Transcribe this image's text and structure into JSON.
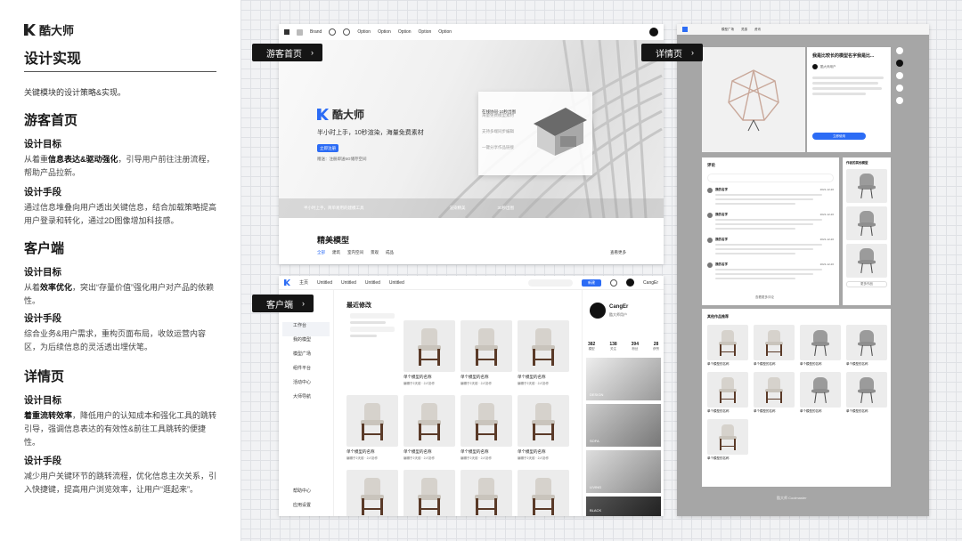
{
  "left": {
    "logo": "酷大师",
    "title": "设计实现",
    "intro": "关键模块的设计策略&实现。",
    "sections": [
      {
        "title": "游客首页",
        "goal_label": "设计目标",
        "goal_pre": "从着重",
        "goal_bold": "信息表达&驱动强化",
        "goal_post": "，引导用户前往注册流程，帮助产品拉新。",
        "means_label": "设计手段",
        "means": "通过信息堆叠向用户透出关键信息，结合加载策略提高用户登录和转化，通过2D图像增加科技感。"
      },
      {
        "title": "客户端",
        "goal_label": "设计目标",
        "goal_pre": "从着",
        "goal_bold": "效率优化",
        "goal_post": "，突出“存量价值”强化用户对产品的依赖性。",
        "means_label": "设计手段",
        "means": "综合业务&用户需求，重构页面布局，收敛运营内容区，为后续信息的灵活透出埋伏笔。"
      },
      {
        "title": "详情页",
        "goal_label": "设计目标",
        "goal_pre": "",
        "goal_bold": "着重流转效率",
        "goal_post": "，降低用户的认知成本和强化工具的跳转引导，强调信息表达的有效性&前往工具跳转的便捷性。",
        "means_label": "设计手段",
        "means": "减少用户关键环节的跳转流程，优化信息主次关系，引入快捷键，提高用户浏览效率，让用户“逛起来”。"
      }
    ]
  },
  "tags": {
    "guest": "游客首页",
    "detail": "详情页",
    "client": "客户端",
    "arrow": "›"
  },
  "guest": {
    "brand": "Brand",
    "options": [
      "Option",
      "Option",
      "Option",
      "Option",
      "Option"
    ],
    "hero_logo": "酷大师",
    "hero_slogan": "半小时上手，10秒渲染，海量免费素材",
    "hero_btn": "立即注册",
    "hero_note": "赠送：注册即送5G储存空间",
    "features": [
      "在线协同·10秒出图",
      "海量免费模型素材",
      "支持多端同步编辑",
      "一键分享作品链接"
    ],
    "strip": [
      "半小时上手，简单易用的建模工具",
      "渲染精美",
      "30秒出图"
    ],
    "section_title": "精美模型",
    "filters": [
      "全部",
      "建筑",
      "室内空间",
      "景观",
      "成品"
    ],
    "more": "查看更多"
  },
  "client": {
    "top_tabs": [
      "主页",
      "Untitled",
      "Untitled",
      "Untitled",
      "Untitled"
    ],
    "new_btn": "新建",
    "user": "CangEr",
    "side_items": [
      "工作台",
      "我的模型",
      "模型广场",
      "组件平台",
      "活动中心",
      "大师导航"
    ],
    "side_bottom": [
      "帮助中心",
      "应用设置"
    ],
    "list_title": "最近修改",
    "filter_groups": [
      "最近修改",
      "最近打开",
      "排序",
      "视图"
    ],
    "card_title": "单个模型的名称",
    "card_meta": [
      "编辑于2天前",
      "2人协作"
    ],
    "profile_name": "CangEr",
    "profile_sub": "酷大师用户",
    "stats": [
      {
        "num": "382",
        "label": "模型"
      },
      {
        "num": "138",
        "label": "关注"
      },
      {
        "num": "394",
        "label": "粉丝"
      },
      {
        "num": "28",
        "label": "获赞"
      }
    ],
    "banners": [
      "DESIGN",
      "SOFA",
      "LIVING",
      "BLACK"
    ]
  },
  "detail": {
    "top_links": [
      "模型广场",
      "灵感",
      "资讯"
    ],
    "model_title": "我是比较长的模型名字我是比...",
    "author": "酷大师用户",
    "use_btn": "立即使用",
    "comments_title": "评论",
    "commenters": [
      "我的名字",
      "我的名字",
      "我的名字",
      "我的名字"
    ],
    "comment_time": "2021-12-20",
    "more_comments": "查看更多评论",
    "side_title": "作者的其他模型",
    "side_more": "更多作品",
    "related_title": "其他作品推荐",
    "related_card": "单个模型的名称",
    "footer": "酷大师 Coolmaster"
  }
}
